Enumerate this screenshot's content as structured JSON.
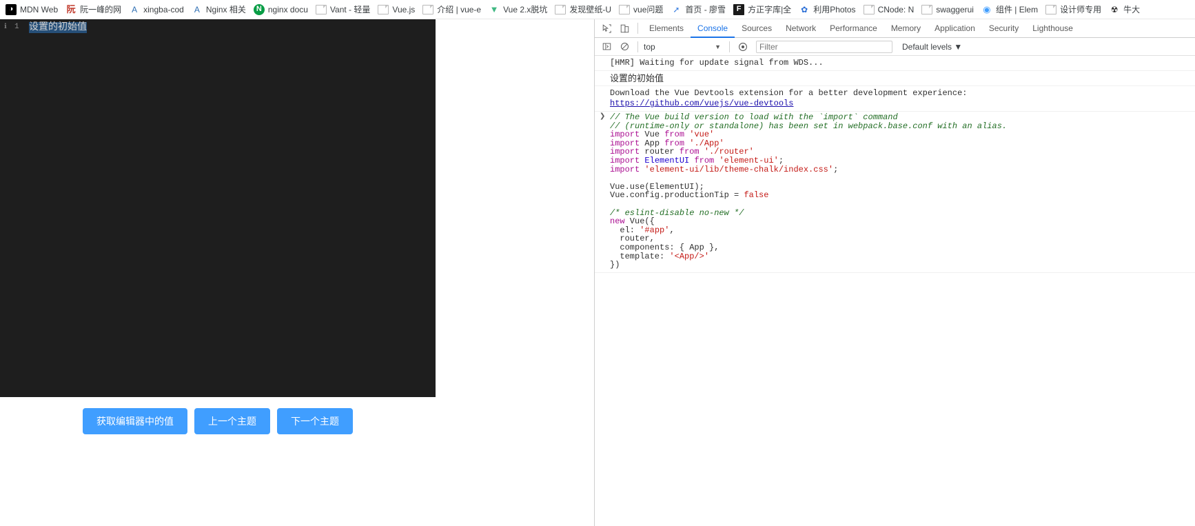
{
  "bookmarks": [
    {
      "label": "MDN Web",
      "icon": "mdn-icon",
      "icon_class": "ico-mdn",
      "glyph": ""
    },
    {
      "label": "阮一峰的网",
      "icon": "ruan-icon",
      "icon_class": "ico-ruan",
      "glyph": "阮"
    },
    {
      "label": "xingba-cod",
      "icon": "bookmark-letter-icon",
      "icon_class": "ico-blue-a",
      "glyph": "A"
    },
    {
      "label": "Nginx 相关",
      "icon": "bookmark-letter-icon",
      "icon_class": "ico-blue-a",
      "glyph": "A"
    },
    {
      "label": "nginx docu",
      "icon": "nginx-icon",
      "icon_class": "ico-nginx",
      "glyph": "N"
    },
    {
      "label": "Vant - 轻量",
      "icon": "page-doc-icon",
      "icon_class": "ico-doc",
      "glyph": ""
    },
    {
      "label": "Vue.js",
      "icon": "page-doc-icon",
      "icon_class": "ico-doc",
      "glyph": ""
    },
    {
      "label": "介绍 | vue-e",
      "icon": "page-doc-icon",
      "icon_class": "ico-doc",
      "glyph": ""
    },
    {
      "label": "Vue 2.x脱坑",
      "icon": "vue-icon",
      "icon_class": "ico-vue",
      "glyph": "▼"
    },
    {
      "label": "发现壁纸-U",
      "icon": "page-doc-icon",
      "icon_class": "ico-doc",
      "glyph": ""
    },
    {
      "label": "vue问题",
      "icon": "page-doc-icon",
      "icon_class": "ico-doc",
      "glyph": ""
    },
    {
      "label": "首页 - 廖雪",
      "icon": "rocket-icon",
      "icon_class": "ico-rocket",
      "glyph": "➚"
    },
    {
      "label": "方正字库|全",
      "icon": "fangzheng-icon",
      "icon_class": "ico-fz",
      "glyph": "F"
    },
    {
      "label": "利用Photos",
      "icon": "baidu-icon",
      "icon_class": "ico-baidu",
      "glyph": "✿"
    },
    {
      "label": "CNode: N",
      "icon": "page-doc-icon",
      "icon_class": "ico-doc",
      "glyph": ""
    },
    {
      "label": "swaggerui",
      "icon": "page-doc-icon",
      "icon_class": "ico-doc",
      "glyph": ""
    },
    {
      "label": "组件 | Elem",
      "icon": "element-icon",
      "icon_class": "ico-elem",
      "glyph": "◉"
    },
    {
      "label": "设计师专用",
      "icon": "page-doc-icon",
      "icon_class": "ico-doc",
      "glyph": ""
    },
    {
      "label": "牛大",
      "icon": "bug-icon",
      "icon_class": "ico-bug",
      "glyph": "☢"
    }
  ],
  "editor": {
    "gutter_fold": "ℹ",
    "gutter_line": "1",
    "code_text": "设置的初始值"
  },
  "page_buttons": [
    {
      "label": "获取编辑器中的值",
      "name": "get-editor-value-button"
    },
    {
      "label": "上一个主题",
      "name": "prev-theme-button"
    },
    {
      "label": "下一个主题",
      "name": "next-theme-button"
    }
  ],
  "devtools": {
    "inspect_icon": "inspect-element-icon",
    "device_icon": "toggle-device-toolbar-icon",
    "tabs": [
      {
        "label": "Elements",
        "active": false
      },
      {
        "label": "Console",
        "active": true
      },
      {
        "label": "Sources",
        "active": false
      },
      {
        "label": "Network",
        "active": false
      },
      {
        "label": "Performance",
        "active": false
      },
      {
        "label": "Memory",
        "active": false
      },
      {
        "label": "Application",
        "active": false
      },
      {
        "label": "Security",
        "active": false
      },
      {
        "label": "Lighthouse",
        "active": false
      }
    ],
    "toolbar": {
      "sidebar_icon": "console-sidebar-icon",
      "clear_icon": "clear-console-icon",
      "context": "top",
      "context_caret": "▼",
      "eye_icon": "live-expression-icon",
      "filter_placeholder": "Filter",
      "filter_value": "",
      "levels_label": "Default levels ▼"
    },
    "console_messages": [
      {
        "type": "plain",
        "text": "[HMR] Waiting for update signal from WDS..."
      },
      {
        "type": "cjk",
        "text": "设置的初始值"
      },
      {
        "type": "link",
        "text": "Download the Vue Devtools extension for a better development experience:",
        "link": "https://github.com/vuejs/vue-devtools"
      }
    ],
    "code_block": {
      "expandable": true,
      "lines": [
        [
          {
            "t": "com",
            "s": "// The Vue build version to load with the `import` command"
          }
        ],
        [
          {
            "t": "com",
            "s": "// (runtime-only or standalone) has been set in webpack.base.conf with an alias."
          }
        ],
        [
          {
            "t": "kw2",
            "s": "import"
          },
          {
            "t": "plain",
            "s": " Vue "
          },
          {
            "t": "kw2",
            "s": "from"
          },
          {
            "t": "plain",
            "s": " "
          },
          {
            "t": "str",
            "s": "'vue'"
          }
        ],
        [
          {
            "t": "kw2",
            "s": "import"
          },
          {
            "t": "plain",
            "s": " App "
          },
          {
            "t": "kw2",
            "s": "from"
          },
          {
            "t": "plain",
            "s": " "
          },
          {
            "t": "str",
            "s": "'./App'"
          }
        ],
        [
          {
            "t": "kw2",
            "s": "import"
          },
          {
            "t": "plain",
            "s": " router "
          },
          {
            "t": "kw2",
            "s": "from"
          },
          {
            "t": "plain",
            "s": " "
          },
          {
            "t": "str",
            "s": "'./router'"
          }
        ],
        [
          {
            "t": "kw2",
            "s": "import"
          },
          {
            "t": "plain",
            "s": " "
          },
          {
            "t": "var",
            "s": "ElementUI"
          },
          {
            "t": "plain",
            "s": " "
          },
          {
            "t": "kw2",
            "s": "from"
          },
          {
            "t": "plain",
            "s": " "
          },
          {
            "t": "str",
            "s": "'element-ui'"
          },
          {
            "t": "plain",
            "s": ";"
          }
        ],
        [
          {
            "t": "kw2",
            "s": "import"
          },
          {
            "t": "plain",
            "s": " "
          },
          {
            "t": "str",
            "s": "'element-ui/lib/theme-chalk/index.css'"
          },
          {
            "t": "plain",
            "s": ";"
          }
        ],
        [
          {
            "t": "plain",
            "s": ""
          }
        ],
        [
          {
            "t": "plain",
            "s": "Vue.use(ElementUI);"
          }
        ],
        [
          {
            "t": "plain",
            "s": "Vue.config.productionTip = "
          },
          {
            "t": "kw",
            "s": "false"
          }
        ],
        [
          {
            "t": "plain",
            "s": ""
          }
        ],
        [
          {
            "t": "com",
            "s": "/* eslint-disable no-new */"
          }
        ],
        [
          {
            "t": "kw2",
            "s": "new"
          },
          {
            "t": "plain",
            "s": " Vue({"
          }
        ],
        [
          {
            "t": "plain",
            "s": "  el: "
          },
          {
            "t": "str",
            "s": "'#app'"
          },
          {
            "t": "plain",
            "s": ","
          }
        ],
        [
          {
            "t": "plain",
            "s": "  router,"
          }
        ],
        [
          {
            "t": "plain",
            "s": "  components: { App },"
          }
        ],
        [
          {
            "t": "plain",
            "s": "  template: "
          },
          {
            "t": "str",
            "s": "'<App/>'"
          }
        ],
        [
          {
            "t": "plain",
            "s": "})"
          }
        ]
      ]
    }
  },
  "colors": {
    "accent_blue": "#409eff",
    "devtools_active_tab": "#1a73e8",
    "editor_bg": "#1e1e1e",
    "selection": "#264f78",
    "comment_green": "#236e25",
    "string_red": "#c41a16",
    "keyword_purple": "#aa0d91",
    "variable_blue": "#1c00cf",
    "link_blue": "#1a0dab"
  }
}
